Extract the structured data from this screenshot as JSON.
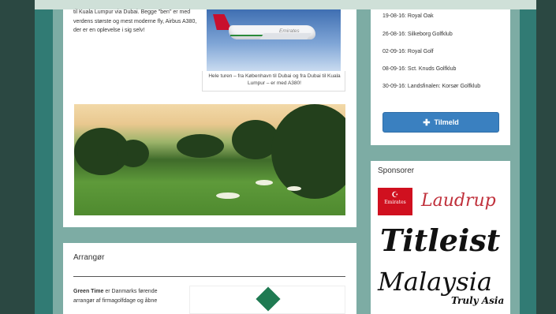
{
  "intro": {
    "text": "til Kuala Lumpur via Dubai. Begge \"ben\" er med verdens største og mest moderne fly, Airbus A380, der er en oplevelse i sig selv!"
  },
  "plane_image": {
    "caption": "Hele turen – fra København til Dubai og fra Dubai til Kuala Lumpur – er med A380!",
    "livery": "Emirates"
  },
  "schedule": {
    "items": [
      "19-08-16: Royal Oak",
      "26-08-16: Silkeborg Golfklub",
      "02-09-16: Royal Golf",
      "08-09-16: Sct. Knuds Golfklub",
      "30-09-16: Landsfinalen: Korsør Golfklub"
    ],
    "signup_label": "Tilmeld",
    "signup_icon": "plus-icon"
  },
  "sponsors": {
    "title": "Sponsorer",
    "logos": [
      "Emirates",
      "Laudrup",
      "Titleist",
      "Malaysia",
      "Truly Asia"
    ]
  },
  "organizer": {
    "title": "Arrangør",
    "text_bold": "Green Time",
    "text_rest": "er Danmarks førende arrangør af firmagolfdage og åbne"
  },
  "colors": {
    "accent": "#3a80c0",
    "background": "#2b4842",
    "panel": "#7daca4",
    "brand_green": "#1f7a52"
  }
}
